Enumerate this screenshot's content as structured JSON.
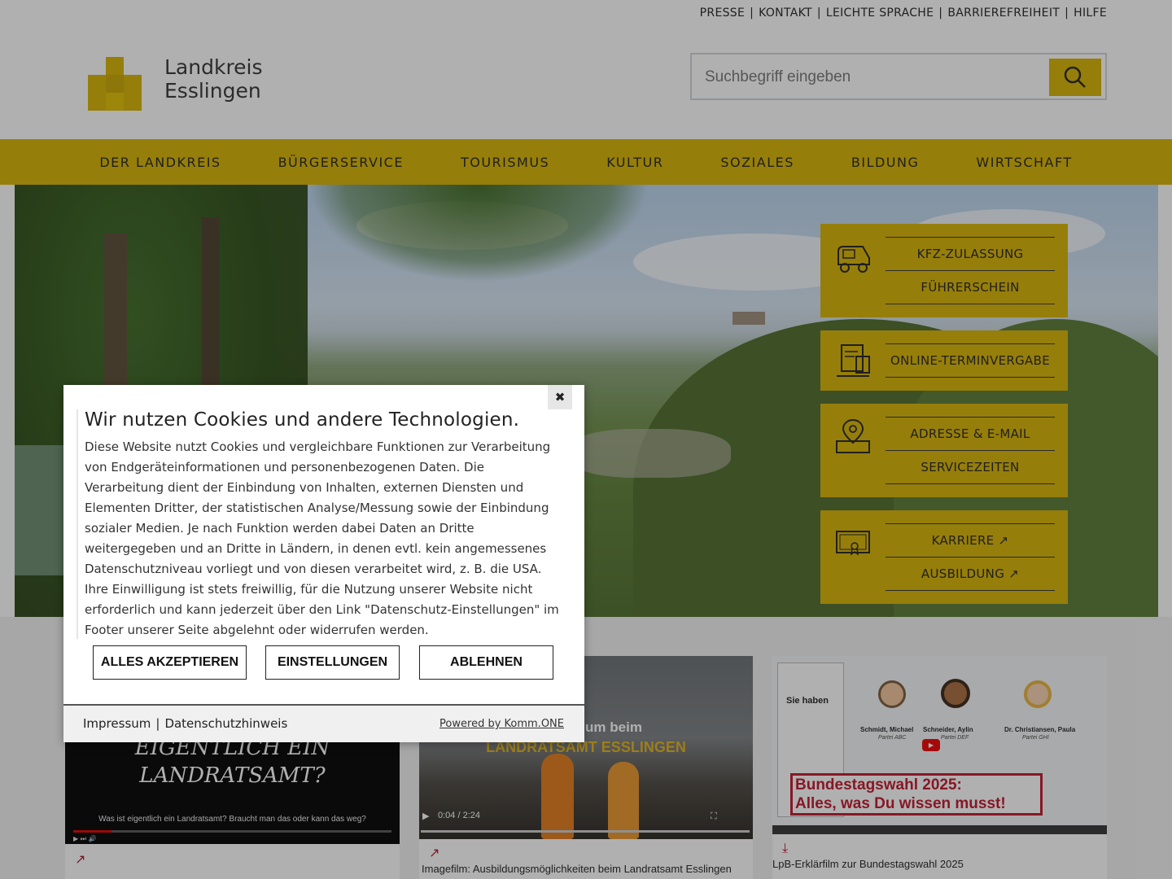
{
  "topnav": [
    "PRESSE",
    "KONTAKT",
    "LEICHTE SPRACHE",
    "BARRIEREFREIHEIT",
    "HILFE"
  ],
  "logo": {
    "line1": "Landkreis",
    "line2": "Esslingen"
  },
  "search": {
    "placeholder": "Suchbegriff eingeben"
  },
  "mainnav": [
    "DER LANDKREIS",
    "BÜRGERSERVICE",
    "TOURISMUS",
    "KULTUR",
    "SOZIALES",
    "BILDUNG",
    "WIRTSCHAFT"
  ],
  "tiles": [
    {
      "icon": "car-icon",
      "links": [
        "KFZ-ZULASSUNG",
        "FÜHRERSCHEIN"
      ]
    },
    {
      "icon": "online-appointment-icon",
      "links": [
        "ONLINE-TERMINVERGABE"
      ]
    },
    {
      "icon": "address-location-icon",
      "links": [
        "ADRESSE & E-MAIL",
        "SERVICEZEITEN"
      ]
    },
    {
      "icon": "certificate-icon",
      "links": [
        "KARRIERE  ↗",
        "AUSBILDUNG  ↗"
      ]
    }
  ],
  "videos": [
    {
      "title_lines": [
        "EIGENTLICH EIN",
        "LANDRATSAMT?"
      ],
      "subtitle": "Was ist eigentlich ein Landratsamt? Braucht man das oder kann das weg?",
      "caption": "",
      "link_icon": "↗"
    },
    {
      "overlay_lines": [
        "nd Studium beim",
        "LANDRATSAMT ESSLINGEN"
      ],
      "time": "0:04 / 2:24",
      "caption": "Imagefilm: Ausbildungsmöglichkeiten beim Landratsamt Esslingen",
      "link_icon": "↗"
    },
    {
      "names": [
        "Schmidt, Michael",
        "Schneider, Aylin",
        "Dr. Christiansen, Paula"
      ],
      "parties": [
        "Partei ABC",
        "Partei DEF",
        "Partei GHI"
      ],
      "headline1": "Bundestagswahl 2025:",
      "headline2": "Alles, was Du wissen musst!",
      "ballot_text": "Sie haben",
      "caption": "LpB-Erklärfilm zur Bundestagswahl 2025",
      "link_icon": "⤓"
    }
  ],
  "cookie": {
    "close": "✖",
    "title": "Wir nutzen Cookies und andere Technologien.",
    "text": "Diese Website nutzt Cookies und vergleichbare Funktionen zur Verarbeitung von Endgeräteinformationen und personenbezogenen Daten. Die Verarbeitung dient der Einbindung von Inhalten, externen Diensten und Elementen Dritter, der statistischen Analyse/Messung sowie der Einbindung sozialer Medien. Je nach Funktion werden dabei Daten an Dritte weitergegeben und an Dritte in Ländern, in denen evtl. kein angemessenes Datenschutzniveau vorliegt und von diesen verarbeitet wird, z. B. die USA. Ihre Einwilligung ist stets freiwillig, für die Nutzung unserer Website nicht erforderlich und kann jederzeit über den Link \"Datenschutz-Einstellungen\" im Footer unserer Seite abgelehnt oder widerrufen werden.",
    "accept": "ALLES AKZEPTIEREN",
    "settings": "EINSTELLUNGEN",
    "decline": "ABLEHNEN",
    "impressum": "Impressum",
    "privacy": "Datenschutzhinweis",
    "powered": "Powered by Komm.ONE"
  },
  "colors": {
    "brand_yellow": "#d8b300",
    "accent_red": "#b0102a"
  }
}
